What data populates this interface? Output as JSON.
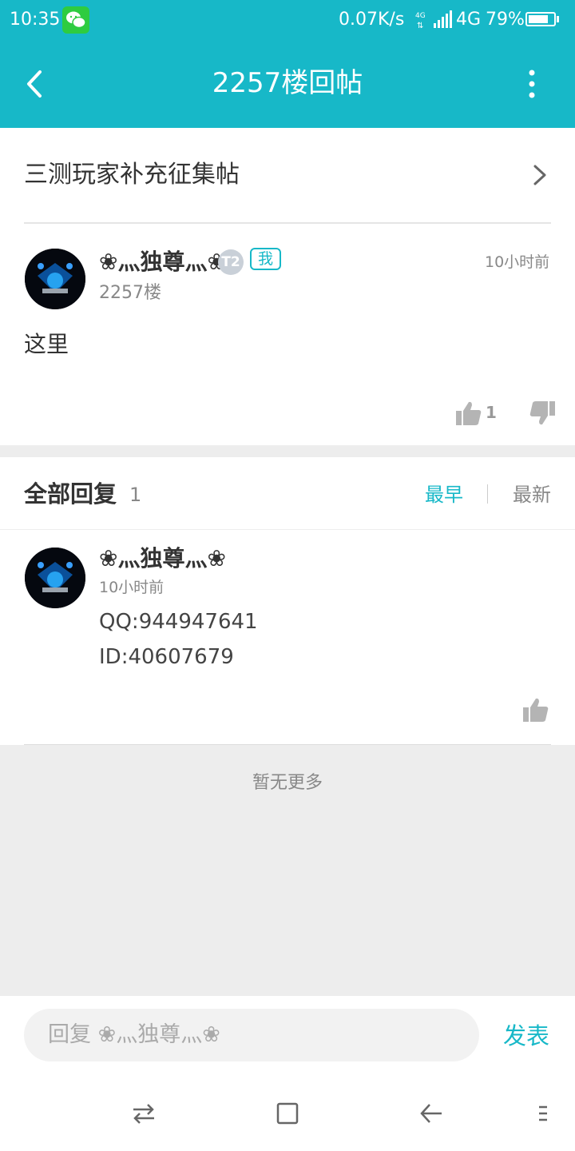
{
  "status_bar": {
    "time": "10:35",
    "network_speed": "0.07K/s",
    "network_type": "4G",
    "battery_percent": "79%",
    "battery_level": 0.79,
    "app_notification_icon": "wechat-icon"
  },
  "header": {
    "back_icon": "chevron-left-icon",
    "title": "2257楼回帖",
    "more_icon": "more-vertical-icon"
  },
  "thread": {
    "title": "三测玩家补充征集帖",
    "author": {
      "name": "❀灬独尊灬❀",
      "level_badge": "T2",
      "self_tag": "我"
    },
    "floor": "2257楼",
    "time": "10小时前",
    "content": "这里",
    "likes": "1"
  },
  "replies_section": {
    "heading": "全部回复",
    "count": "1",
    "sort_earliest": "最早",
    "sort_newest": "最新"
  },
  "replies": [
    {
      "author": "❀灬独尊灬❀",
      "time": "10小时前",
      "lines": [
        "QQ:944947641",
        "ID:40607679"
      ]
    }
  ],
  "no_more_text": "暂无更多",
  "composer": {
    "placeholder": "回复 ❀灬独尊灬❀",
    "submit_label": "发表"
  },
  "system_nav": {
    "icons": [
      "switch-apps-icon",
      "home-square-icon",
      "back-arrow-icon",
      "menu-icon"
    ]
  },
  "colors": {
    "accent": "#17b8c8",
    "background": "#ededed"
  }
}
